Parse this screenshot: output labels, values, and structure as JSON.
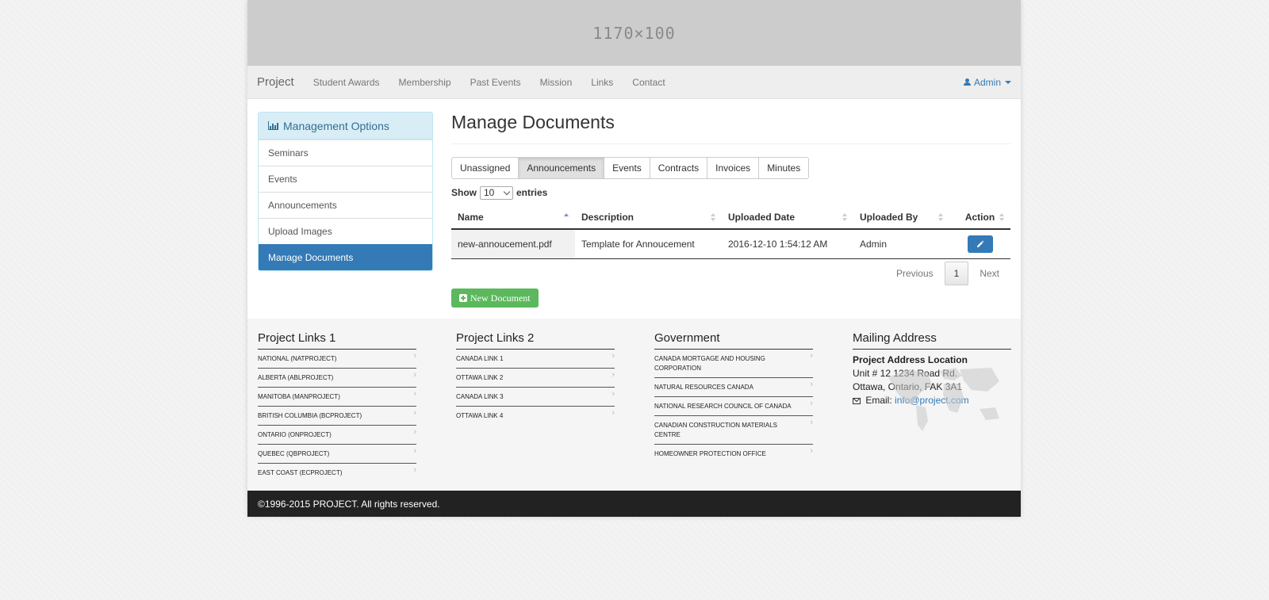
{
  "banner": {
    "placeholder_text": "1170×100"
  },
  "navbar": {
    "brand": "Project",
    "links": [
      "Student Awards",
      "Membership",
      "Past Events",
      "Mission",
      "Links",
      "Contact"
    ],
    "user": "Admin"
  },
  "sidebar": {
    "title": "Management Options",
    "items": [
      {
        "label": "Seminars"
      },
      {
        "label": "Events"
      },
      {
        "label": "Announcements"
      },
      {
        "label": "Upload Images"
      },
      {
        "label": "Manage Documents",
        "active": true
      }
    ]
  },
  "main": {
    "title": "Manage Documents",
    "tabs": [
      {
        "label": "Unassigned"
      },
      {
        "label": "Announcements",
        "active": true
      },
      {
        "label": "Events"
      },
      {
        "label": "Contracts"
      },
      {
        "label": "Invoices"
      },
      {
        "label": "Minutes"
      }
    ],
    "show_label": "Show",
    "entries_value": "10",
    "entries_label": "entries",
    "table": {
      "headers": [
        "Name",
        "Description",
        "Uploaded Date",
        "Uploaded By",
        "Action"
      ],
      "rows": [
        [
          "new-annoucement.pdf",
          "Template for Annoucement",
          "2016-12-10 1:54:12 AM",
          "Admin"
        ]
      ]
    },
    "pagination": {
      "previous": "Previous",
      "current": "1",
      "next": "Next"
    },
    "new_button": "New Document"
  },
  "footer": {
    "col1": {
      "title": "Project Links 1",
      "links": [
        "NATIONAL (NATPROJECT)",
        "ALBERTA (ABLPROJECT)",
        "MANITOBA (MANPROJECT)",
        "BRITISH COLUMBIA (BCPROJECT)",
        "ONTARIO (ONPROJECT)",
        "QUEBEC (QBPROJECT)",
        "EAST COAST (ECPROJECT)"
      ]
    },
    "col2": {
      "title": "Project Links 2",
      "links": [
        "CANADA LINK 1",
        "OTTAWA LINK 2",
        "CANADA LINK 3",
        "OTTAWA LINK 4"
      ]
    },
    "col3": {
      "title": "Government",
      "links": [
        "CANADA MORTGAGE AND HOUSING CORPORATION",
        "NATURAL RESOURCES CANADA",
        "NATIONAL RESEARCH COUNCIL OF CANADA",
        "CANADIAN CONSTRUCTION MATERIALS CENTRE",
        "HOMEOWNER PROTECTION OFFICE"
      ]
    },
    "mailing": {
      "title": "Mailing Address",
      "name": "Project Address Location",
      "line1": "Unit # 12 1234 Road Rd.",
      "line2": "Ottawa, Ontario, FAK 3A1",
      "email_label": "Email:",
      "email": "info@project.com"
    },
    "copyright": "©1996-2015 PROJECT. All rights reserved."
  },
  "colors": {
    "primary": "#337ab7",
    "success": "#5cb85c",
    "panel_heading": "#d9edf7",
    "footer_bar": "#222222"
  }
}
